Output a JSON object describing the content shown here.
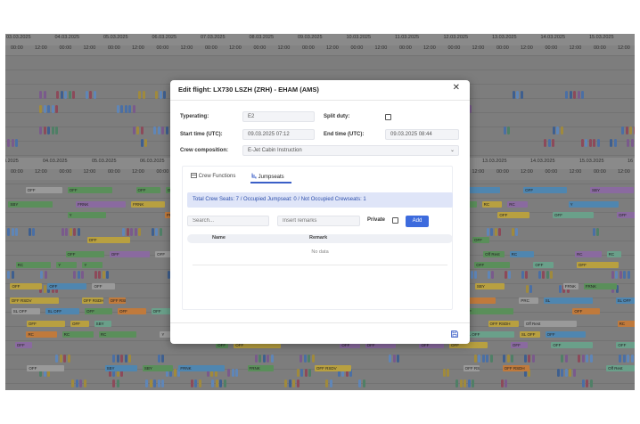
{
  "schedule": {
    "dates_top": [
      "03.03.2025",
      "04.03.2025",
      "05.03.2025",
      "06.03.2025",
      "07.03.2025",
      "08.03.2025",
      "09.03.2025",
      "10.03.2025",
      "11.03.2025",
      "12.03.2025",
      "13.03.2025",
      "14.03.2025",
      "15.03.2025",
      "16"
    ],
    "dates_mid": [
      "3.2025",
      "04.03.2025",
      "05.03.2025",
      "06.03.2025",
      "13.03.2025",
      "14.03.2025",
      "15.03.2025",
      "16"
    ],
    "time_00": "00:00",
    "time_12": "12:00",
    "block_labels": [
      "OFF",
      "OFF",
      "OFF",
      "OFF",
      "OFF",
      "OFF",
      "OFF",
      "OFF",
      "OFF",
      "SBY",
      "SBY",
      "FRNK",
      "FRNK",
      "OFF RSDV",
      "OFF RSDH",
      "OFF RSDH",
      "Off Rest",
      "RC",
      "RC",
      "RC",
      "RC",
      "Y",
      "Y",
      "PRC",
      "SL",
      "SL OFF",
      "SL OFF",
      "SL OFF",
      "OFF",
      "OFF",
      "OFF"
    ]
  },
  "modal": {
    "title": "Edit flight: LX730 LSZH (ZRH) - EHAM (AMS)",
    "close_icon": "close-icon",
    "typerating_label": "Typerating:",
    "typerating_value": "E2",
    "split_duty_label": "Split duty:",
    "split_duty_checked": false,
    "start_time_label": "Start time (UTC):",
    "start_time_value": "09.03.2025 07:12",
    "end_time_label": "End time (UTC):",
    "end_time_value": "09.03.2025 08:44",
    "crew_composition_label": "Crew composition:",
    "crew_composition_value": "E-Jet Cabin Instruction",
    "tabs": [
      {
        "label": "Crew Functions",
        "icon": "crew-functions-icon",
        "active": false
      },
      {
        "label": "Jumpseats",
        "icon": "jumpseat-icon",
        "active": true
      }
    ],
    "info_text": "Total Crew Seats: 7 / Occupied Jumpseat: 0 / Not Occupied Crewseats: 1",
    "search_placeholder": "Search...",
    "remarks_placeholder": "Insert remarks",
    "private_label": "Private",
    "private_checked": false,
    "add_button": "Add",
    "table_headers": [
      "Name",
      "Remark"
    ],
    "no_data": "No data",
    "save_icon": "save-icon",
    "accent_color": "#3d6bdd"
  }
}
